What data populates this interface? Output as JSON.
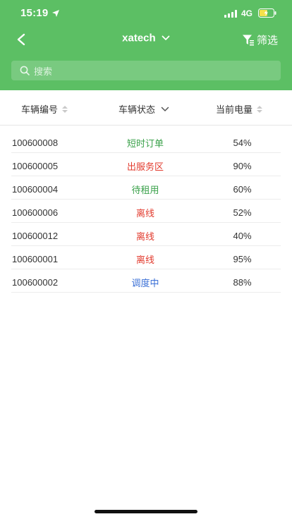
{
  "status_bar": {
    "time": "15:19",
    "network": "4G"
  },
  "nav": {
    "title": "xatech",
    "filter_label": "筛选"
  },
  "search": {
    "placeholder": "搜索"
  },
  "table": {
    "headers": [
      "车辆编号",
      "车辆状态",
      "当前电量"
    ],
    "rows": [
      {
        "id": "100600008",
        "status": "短时订单",
        "battery": "54%"
      },
      {
        "id": "100600005",
        "status": "出服务区",
        "battery": "90%"
      },
      {
        "id": "100600004",
        "status": "待租用",
        "battery": "60%"
      },
      {
        "id": "100600006",
        "status": "离线",
        "battery": "52%"
      },
      {
        "id": "100600012",
        "status": "离线",
        "battery": "40%"
      },
      {
        "id": "100600001",
        "status": "离线",
        "battery": "95%"
      },
      {
        "id": "100600002",
        "status": "调度中",
        "battery": "88%"
      }
    ]
  },
  "colors": {
    "header_green": "#5cbf64",
    "status_green": "#3aa14a",
    "status_red": "#e23b2e",
    "status_blue": "#3a6fd6"
  }
}
